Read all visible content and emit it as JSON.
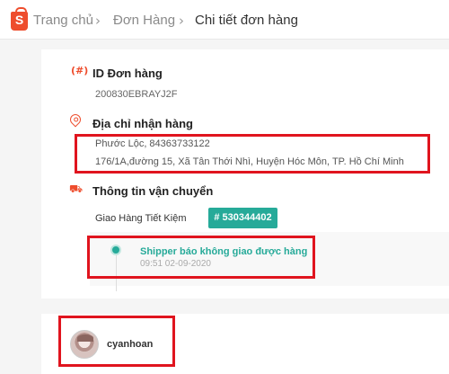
{
  "breadcrumb": {
    "home": "Trang chủ",
    "orders": "Đơn Hàng",
    "current": "Chi tiết đơn hàng",
    "separator": "›"
  },
  "logo": {
    "letter": "S"
  },
  "order": {
    "id_title": "ID Đơn hàng",
    "id_icon": "(#)",
    "id_value": "200830EBRAYJ2F"
  },
  "address": {
    "title": "Địa chỉ nhận hàng",
    "name_phone": "Phước Lộc, 84363733122",
    "line": "176/1A,đường 15, Xã Tân Thới Nhì, Huyện Hóc Môn, TP. Hồ Chí Minh"
  },
  "shipping": {
    "title": "Thông tin vận chuyển",
    "truck_icon": "⛟",
    "carrier": "Giao Hàng Tiết Kiệm",
    "tracking": "# 530344402",
    "status": "Shipper báo không giao được hàng",
    "time": "09:51 02-09-2020"
  },
  "buyer": {
    "username": "cyanhoan"
  },
  "colors": {
    "brand": "#ee4d2d",
    "teal": "#26aa99",
    "highlight": "#e0141e"
  }
}
